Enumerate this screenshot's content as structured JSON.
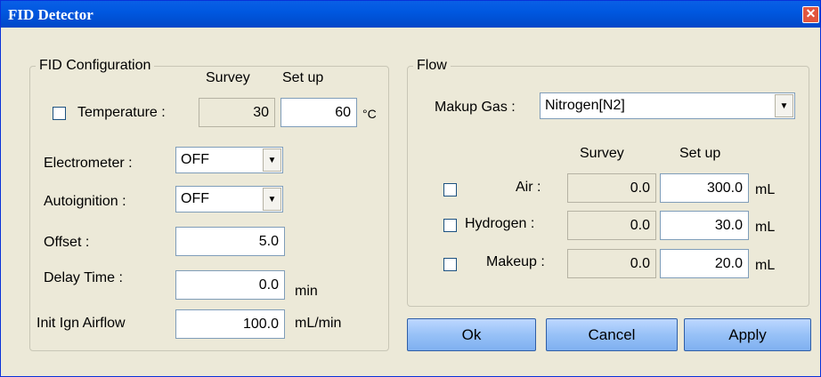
{
  "window": {
    "title": "FID Detector",
    "close_symbol": "✕"
  },
  "config": {
    "legend": "FID Configuration",
    "col_survey": "Survey",
    "col_setup": "Set up",
    "temperature": {
      "label": "Temperature :",
      "survey": "30",
      "setup": "60",
      "unit": "°C",
      "checked": false
    },
    "electrometer": {
      "label": "Electrometer :",
      "value": "OFF"
    },
    "autoignition": {
      "label": "Autoignition :",
      "value": "OFF"
    },
    "offset": {
      "label": "Offset :",
      "value": "5.0"
    },
    "delay_time": {
      "label": "Delay Time :",
      "value": "0.0",
      "unit": "min"
    },
    "init_ign_airflow": {
      "label": "Init Ign Airflow",
      "value": "100.0",
      "unit": "mL/min"
    }
  },
  "flow": {
    "legend": "Flow",
    "makeup_gas": {
      "label": "Makup Gas :",
      "value": "Nitrogen[N2]"
    },
    "col_survey": "Survey",
    "col_setup": "Set up",
    "rows": [
      {
        "label": "Air :",
        "survey": "0.0",
        "setup": "300.0",
        "unit": "mL"
      },
      {
        "label": "Hydrogen :",
        "survey": "0.0",
        "setup": "30.0",
        "unit": "mL"
      },
      {
        "label": "Makeup :",
        "survey": "0.0",
        "setup": "20.0",
        "unit": "mL"
      }
    ]
  },
  "buttons": {
    "ok": "Ok",
    "cancel": "Cancel",
    "apply": "Apply"
  }
}
